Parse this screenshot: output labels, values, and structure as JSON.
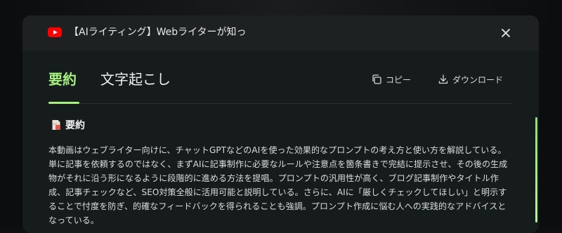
{
  "dialog": {
    "title": "【AIライティング】Webライターが知っ",
    "close_icon": "close-icon",
    "source_icon": "youtube-icon"
  },
  "tabs": [
    {
      "label": "要約",
      "active": true
    },
    {
      "label": "文字起こし",
      "active": false
    }
  ],
  "actions": {
    "copy_label": "コピー",
    "download_label": "ダウンロード"
  },
  "summary": {
    "heading": "要約",
    "text": "本動画はウェブライター向けに、チャットGPTなどのAIを使った効果的なプロンプトの考え方と使い方を解説している。単に記事を依頼するのではなく、まずAIに記事制作に必要なルールや注意点を箇条書きで完結に提示させ、その後の生成物がそれに沿う形になるように段階的に進める方法を提唱。プロンプトの汎用性が高く、ブログ記事制作やタイトル作成、記事チェックなど、SEO対策全般に活用可能と説明している。さらに、AIに「厳しくチェックしてほしい」と明示することで忖度を防ぎ、的確なフィードバックを得られることも強調。プロンプト作成に悩む人への実践的なアドバイスとなっている。"
  },
  "colors": {
    "accent": "#a6f07f",
    "modal_bg": "#161b1c",
    "header_bg": "#1e2122",
    "brand_red": "#ff0000"
  }
}
